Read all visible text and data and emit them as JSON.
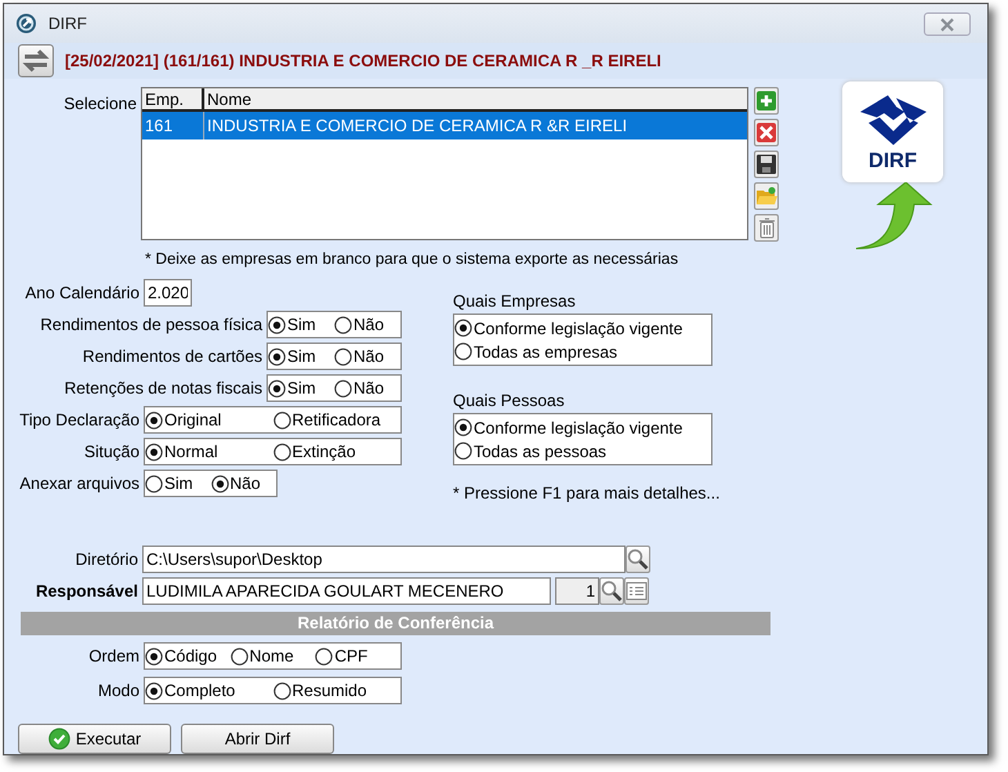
{
  "window": {
    "title": "DIRF"
  },
  "header": {
    "title": "[25/02/2021] (161/161) INDUSTRIA E COMERCIO DE CERAMICA R _R EIRELI"
  },
  "companies": {
    "label": "Selecione",
    "columns": [
      "Emp.",
      "Nome"
    ],
    "rows": [
      {
        "cells": [
          "161",
          "INDUSTRIA E COMERCIO DE CERAMICA R &R EIRELI"
        ],
        "selected": true
      }
    ],
    "note": "* Deixe as empresas em branco para que o sistema exporte as necessárias"
  },
  "logo": {
    "text": "DIRF"
  },
  "year": {
    "label": "Ano Calendário",
    "value": "2.020"
  },
  "options": [
    {
      "label": "Rendimentos de pessoa física",
      "kind": "yesno",
      "choices": [
        {
          "label": "Sim",
          "selected": true
        },
        {
          "label": "Não",
          "selected": false
        }
      ]
    },
    {
      "label": "Rendimentos de cartões",
      "kind": "yesno",
      "choices": [
        {
          "label": "Sim",
          "selected": true
        },
        {
          "label": "Não",
          "selected": false
        }
      ]
    },
    {
      "label": "Retenções de notas fiscais",
      "kind": "yesno",
      "choices": [
        {
          "label": "Sim",
          "selected": true
        },
        {
          "label": "Não",
          "selected": false
        }
      ]
    },
    {
      "label": "Tipo Declaração",
      "kind": "wide",
      "choices": [
        {
          "label": "Original",
          "selected": true
        },
        {
          "label": "Retificadora",
          "selected": false
        }
      ]
    },
    {
      "label": "Situção",
      "kind": "wide",
      "choices": [
        {
          "label": "Normal",
          "selected": true
        },
        {
          "label": "Extinção",
          "selected": false
        }
      ]
    },
    {
      "label": "Anexar arquivos",
      "kind": "compact",
      "choices": [
        {
          "label": "Sim",
          "selected": false
        },
        {
          "label": "Não",
          "selected": true
        }
      ]
    }
  ],
  "groups": [
    {
      "label": "Quais Empresas",
      "choices": [
        {
          "label": "Conforme legislação vigente",
          "selected": true
        },
        {
          "label": "Todas as empresas",
          "selected": false
        }
      ]
    },
    {
      "label": "Quais Pessoas",
      "choices": [
        {
          "label": "Conforme legislação vigente",
          "selected": true
        },
        {
          "label": "Todas as pessoas",
          "selected": false
        }
      ]
    }
  ],
  "help_note": "* Pressione F1 para mais detalhes...",
  "directory": {
    "label": "Diretório",
    "value": "C:\\Users\\supor\\Desktop"
  },
  "responsible": {
    "label": "Responsável",
    "value": "LUDIMILA APARECIDA GOULART MECENERO",
    "code": "1"
  },
  "report": {
    "title": "Relatório de Conferência",
    "options": [
      {
        "label": "Ordem",
        "choices": [
          {
            "label": "Código",
            "selected": true
          },
          {
            "label": "Nome",
            "selected": false
          },
          {
            "label": "CPF",
            "selected": false
          }
        ]
      },
      {
        "label": "Modo",
        "choices": [
          {
            "label": "Completo",
            "selected": true
          },
          {
            "label": "Resumido",
            "selected": false
          }
        ]
      }
    ]
  },
  "buttons": [
    {
      "label": "Executar",
      "kind": "execute"
    },
    {
      "label": "Abrir Dirf",
      "kind": "plain"
    }
  ]
}
